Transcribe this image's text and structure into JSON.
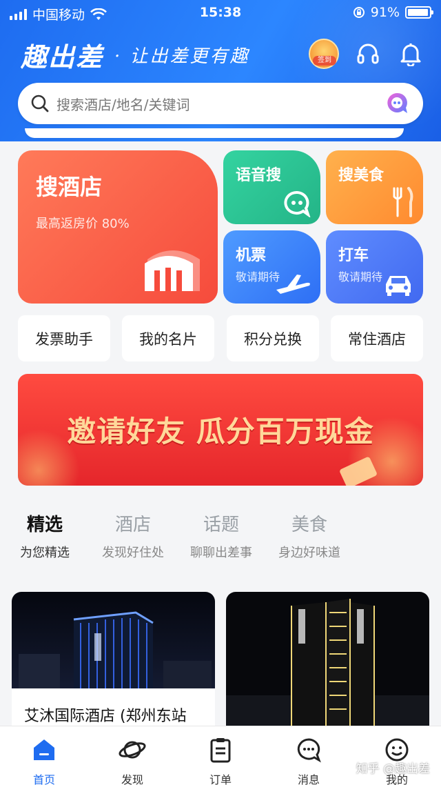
{
  "status_bar": {
    "carrier": "中国移动",
    "time": "15:38",
    "battery": "91%"
  },
  "header": {
    "logo": "趣出差",
    "slogan": "· 让出差更有趣",
    "checkin_label": "签到",
    "icons": [
      "checkin-badge",
      "headset-icon",
      "bell-icon"
    ]
  },
  "search": {
    "placeholder": "搜索酒店/地名/关键词"
  },
  "features": {
    "hotel": {
      "title": "搜酒店",
      "subtitle": "最高返房价 80%"
    },
    "voice": {
      "title": "语音搜"
    },
    "food": {
      "title": "搜美食"
    },
    "flight": {
      "title": "机票",
      "subtitle": "敬请期待"
    },
    "taxi": {
      "title": "打车",
      "subtitle": "敬请期待"
    }
  },
  "quick_links": [
    "发票助手",
    "我的名片",
    "积分兑换",
    "常住酒店"
  ],
  "banner": {
    "text": "邀请好友 瓜分百万现金"
  },
  "tabs": [
    {
      "title": "精选",
      "subtitle": "为您精选"
    },
    {
      "title": "酒店",
      "subtitle": "发现好住处"
    },
    {
      "title": "话题",
      "subtitle": "聊聊出差事"
    },
    {
      "title": "美食",
      "subtitle": "身边好味道"
    }
  ],
  "hotels": [
    {
      "name": "艾沐国际酒店 (郑州东站"
    },
    {
      "name": ""
    }
  ],
  "bottom_nav": [
    {
      "label": "首页",
      "active": true
    },
    {
      "label": "发现"
    },
    {
      "label": "订单"
    },
    {
      "label": "消息"
    },
    {
      "label": "我的"
    }
  ],
  "watermark": "知乎 @趣出差",
  "colors": {
    "brand_blue": "#1e6cf0",
    "hotel_red": "#f64b3c",
    "voice_green": "#24b487",
    "food_orange": "#ff8a2f"
  }
}
